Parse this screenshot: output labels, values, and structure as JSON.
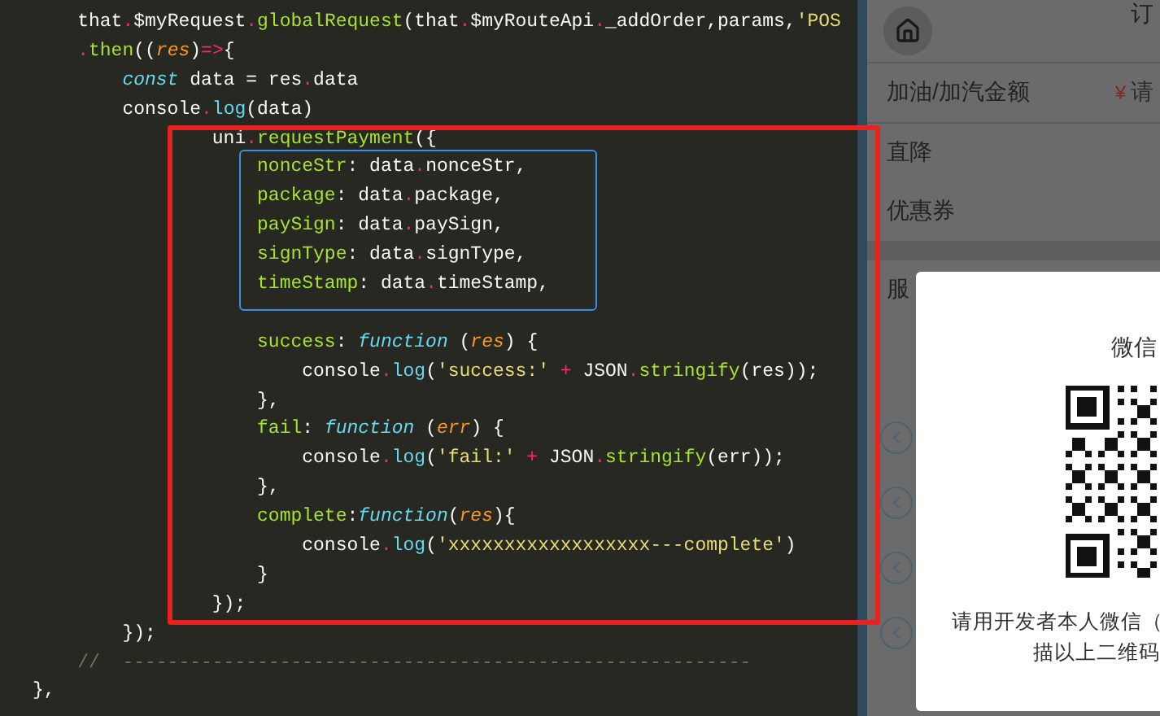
{
  "editor": {
    "lines": [
      {
        "tokens": [
          {
            "kind": "p",
            "text": "    that"
          },
          {
            "kind": "o",
            "text": "."
          },
          {
            "kind": "p",
            "text": "$myRequest"
          },
          {
            "kind": "o",
            "text": "."
          },
          {
            "kind": "f",
            "text": "globalRequest"
          },
          {
            "kind": "p",
            "text": "(that"
          },
          {
            "kind": "o",
            "text": "."
          },
          {
            "kind": "p",
            "text": "$myRouteApi"
          },
          {
            "kind": "o",
            "text": "."
          },
          {
            "kind": "p",
            "text": "_addOrder,params,"
          },
          {
            "kind": "s",
            "text": "'POS"
          }
        ]
      },
      {
        "tokens": [
          {
            "kind": "o",
            "text": "    ."
          },
          {
            "kind": "f",
            "text": "then"
          },
          {
            "kind": "p",
            "text": "(("
          },
          {
            "kind": "a",
            "text": "res"
          },
          {
            "kind": "p",
            "text": ")"
          },
          {
            "kind": "o",
            "text": "=>"
          },
          {
            "kind": "p",
            "text": "{"
          }
        ]
      },
      {
        "tokens": [
          {
            "kind": "k",
            "text": "        const"
          },
          {
            "kind": "p",
            "text": " data = res"
          },
          {
            "kind": "o",
            "text": "."
          },
          {
            "kind": "p",
            "text": "data"
          }
        ]
      },
      {
        "tokens": [
          {
            "kind": "p",
            "text": "        console"
          },
          {
            "kind": "o",
            "text": "."
          },
          {
            "kind": "m",
            "text": "log"
          },
          {
            "kind": "p",
            "text": "(data)"
          }
        ]
      },
      {
        "tokens": [
          {
            "kind": "p",
            "text": "                uni"
          },
          {
            "kind": "o",
            "text": "."
          },
          {
            "kind": "f",
            "text": "requestPayment"
          },
          {
            "kind": "p",
            "text": "({"
          }
        ]
      },
      {
        "tokens": [
          {
            "kind": "f",
            "text": "                    nonceStr"
          },
          {
            "kind": "p",
            "text": ": data"
          },
          {
            "kind": "o",
            "text": "."
          },
          {
            "kind": "p",
            "text": "nonceStr,"
          }
        ]
      },
      {
        "tokens": [
          {
            "kind": "f",
            "text": "                    package"
          },
          {
            "kind": "p",
            "text": ": data"
          },
          {
            "kind": "o",
            "text": "."
          },
          {
            "kind": "p",
            "text": "package,"
          }
        ]
      },
      {
        "tokens": [
          {
            "kind": "f",
            "text": "                    paySign"
          },
          {
            "kind": "p",
            "text": ": data"
          },
          {
            "kind": "o",
            "text": "."
          },
          {
            "kind": "p",
            "text": "paySign,"
          }
        ]
      },
      {
        "tokens": [
          {
            "kind": "f",
            "text": "                    signType"
          },
          {
            "kind": "p",
            "text": ": data"
          },
          {
            "kind": "o",
            "text": "."
          },
          {
            "kind": "p",
            "text": "signType,"
          }
        ]
      },
      {
        "tokens": [
          {
            "kind": "f",
            "text": "                    timeStamp"
          },
          {
            "kind": "p",
            "text": ": data"
          },
          {
            "kind": "o",
            "text": "."
          },
          {
            "kind": "p",
            "text": "timeStamp,"
          }
        ]
      },
      {
        "gap_before": true,
        "tokens": [
          {
            "kind": "f",
            "text": "                    success"
          },
          {
            "kind": "p",
            "text": ": "
          },
          {
            "kind": "k",
            "text": "function"
          },
          {
            "kind": "p",
            "text": " ("
          },
          {
            "kind": "a",
            "text": "res"
          },
          {
            "kind": "p",
            "text": ") {"
          }
        ]
      },
      {
        "tokens": [
          {
            "kind": "p",
            "text": "                        console"
          },
          {
            "kind": "o",
            "text": "."
          },
          {
            "kind": "m",
            "text": "log"
          },
          {
            "kind": "p",
            "text": "("
          },
          {
            "kind": "s",
            "text": "'success:'"
          },
          {
            "kind": "o",
            "text": " +"
          },
          {
            "kind": "p",
            "text": " JSON"
          },
          {
            "kind": "o",
            "text": "."
          },
          {
            "kind": "f",
            "text": "stringify"
          },
          {
            "kind": "p",
            "text": "(res));"
          }
        ]
      },
      {
        "tokens": [
          {
            "kind": "p",
            "text": "                    },"
          }
        ]
      },
      {
        "tokens": [
          {
            "kind": "f",
            "text": "                    fail"
          },
          {
            "kind": "p",
            "text": ": "
          },
          {
            "kind": "k",
            "text": "function"
          },
          {
            "kind": "p",
            "text": " ("
          },
          {
            "kind": "a",
            "text": "err"
          },
          {
            "kind": "p",
            "text": ") {"
          }
        ]
      },
      {
        "tokens": [
          {
            "kind": "p",
            "text": "                        console"
          },
          {
            "kind": "o",
            "text": "."
          },
          {
            "kind": "m",
            "text": "log"
          },
          {
            "kind": "p",
            "text": "("
          },
          {
            "kind": "s",
            "text": "'fail:'"
          },
          {
            "kind": "o",
            "text": " +"
          },
          {
            "kind": "p",
            "text": " JSON"
          },
          {
            "kind": "o",
            "text": "."
          },
          {
            "kind": "f",
            "text": "stringify"
          },
          {
            "kind": "p",
            "text": "(err));"
          }
        ]
      },
      {
        "tokens": [
          {
            "kind": "p",
            "text": "                    },"
          }
        ]
      },
      {
        "tokens": [
          {
            "kind": "f",
            "text": "                    complete"
          },
          {
            "kind": "p",
            "text": ":"
          },
          {
            "kind": "k",
            "text": "function"
          },
          {
            "kind": "p",
            "text": "("
          },
          {
            "kind": "a",
            "text": "res"
          },
          {
            "kind": "p",
            "text": "){"
          }
        ]
      },
      {
        "tokens": [
          {
            "kind": "p",
            "text": "                        console"
          },
          {
            "kind": "o",
            "text": "."
          },
          {
            "kind": "m",
            "text": "log"
          },
          {
            "kind": "p",
            "text": "("
          },
          {
            "kind": "s",
            "text": "'xxxxxxxxxxxxxxxxxx---complete'"
          },
          {
            "kind": "p",
            "text": ")"
          }
        ]
      },
      {
        "tokens": [
          {
            "kind": "p",
            "text": "                    }"
          }
        ]
      },
      {
        "tokens": [
          {
            "kind": "p",
            "text": "                });"
          }
        ]
      },
      {
        "tokens": [
          {
            "kind": "p",
            "text": "        });"
          }
        ]
      },
      {
        "tokens": [
          {
            "kind": "c",
            "text": "    //  --------------------------------------------------------"
          }
        ]
      },
      {
        "tokens": [
          {
            "kind": "p",
            "text": "},"
          }
        ]
      }
    ]
  },
  "phone": {
    "header_title": "订",
    "rows": [
      {
        "label": "加油/加汽金额",
        "currency": "¥",
        "placeholder": "请"
      },
      {
        "label": "直降"
      },
      {
        "label": "优惠券"
      },
      {
        "label": "服"
      }
    ],
    "dialog": {
      "title": "微信",
      "message_lines": [
        "请用开发者本人微信（",
        "描以上二维码"
      ]
    }
  }
}
